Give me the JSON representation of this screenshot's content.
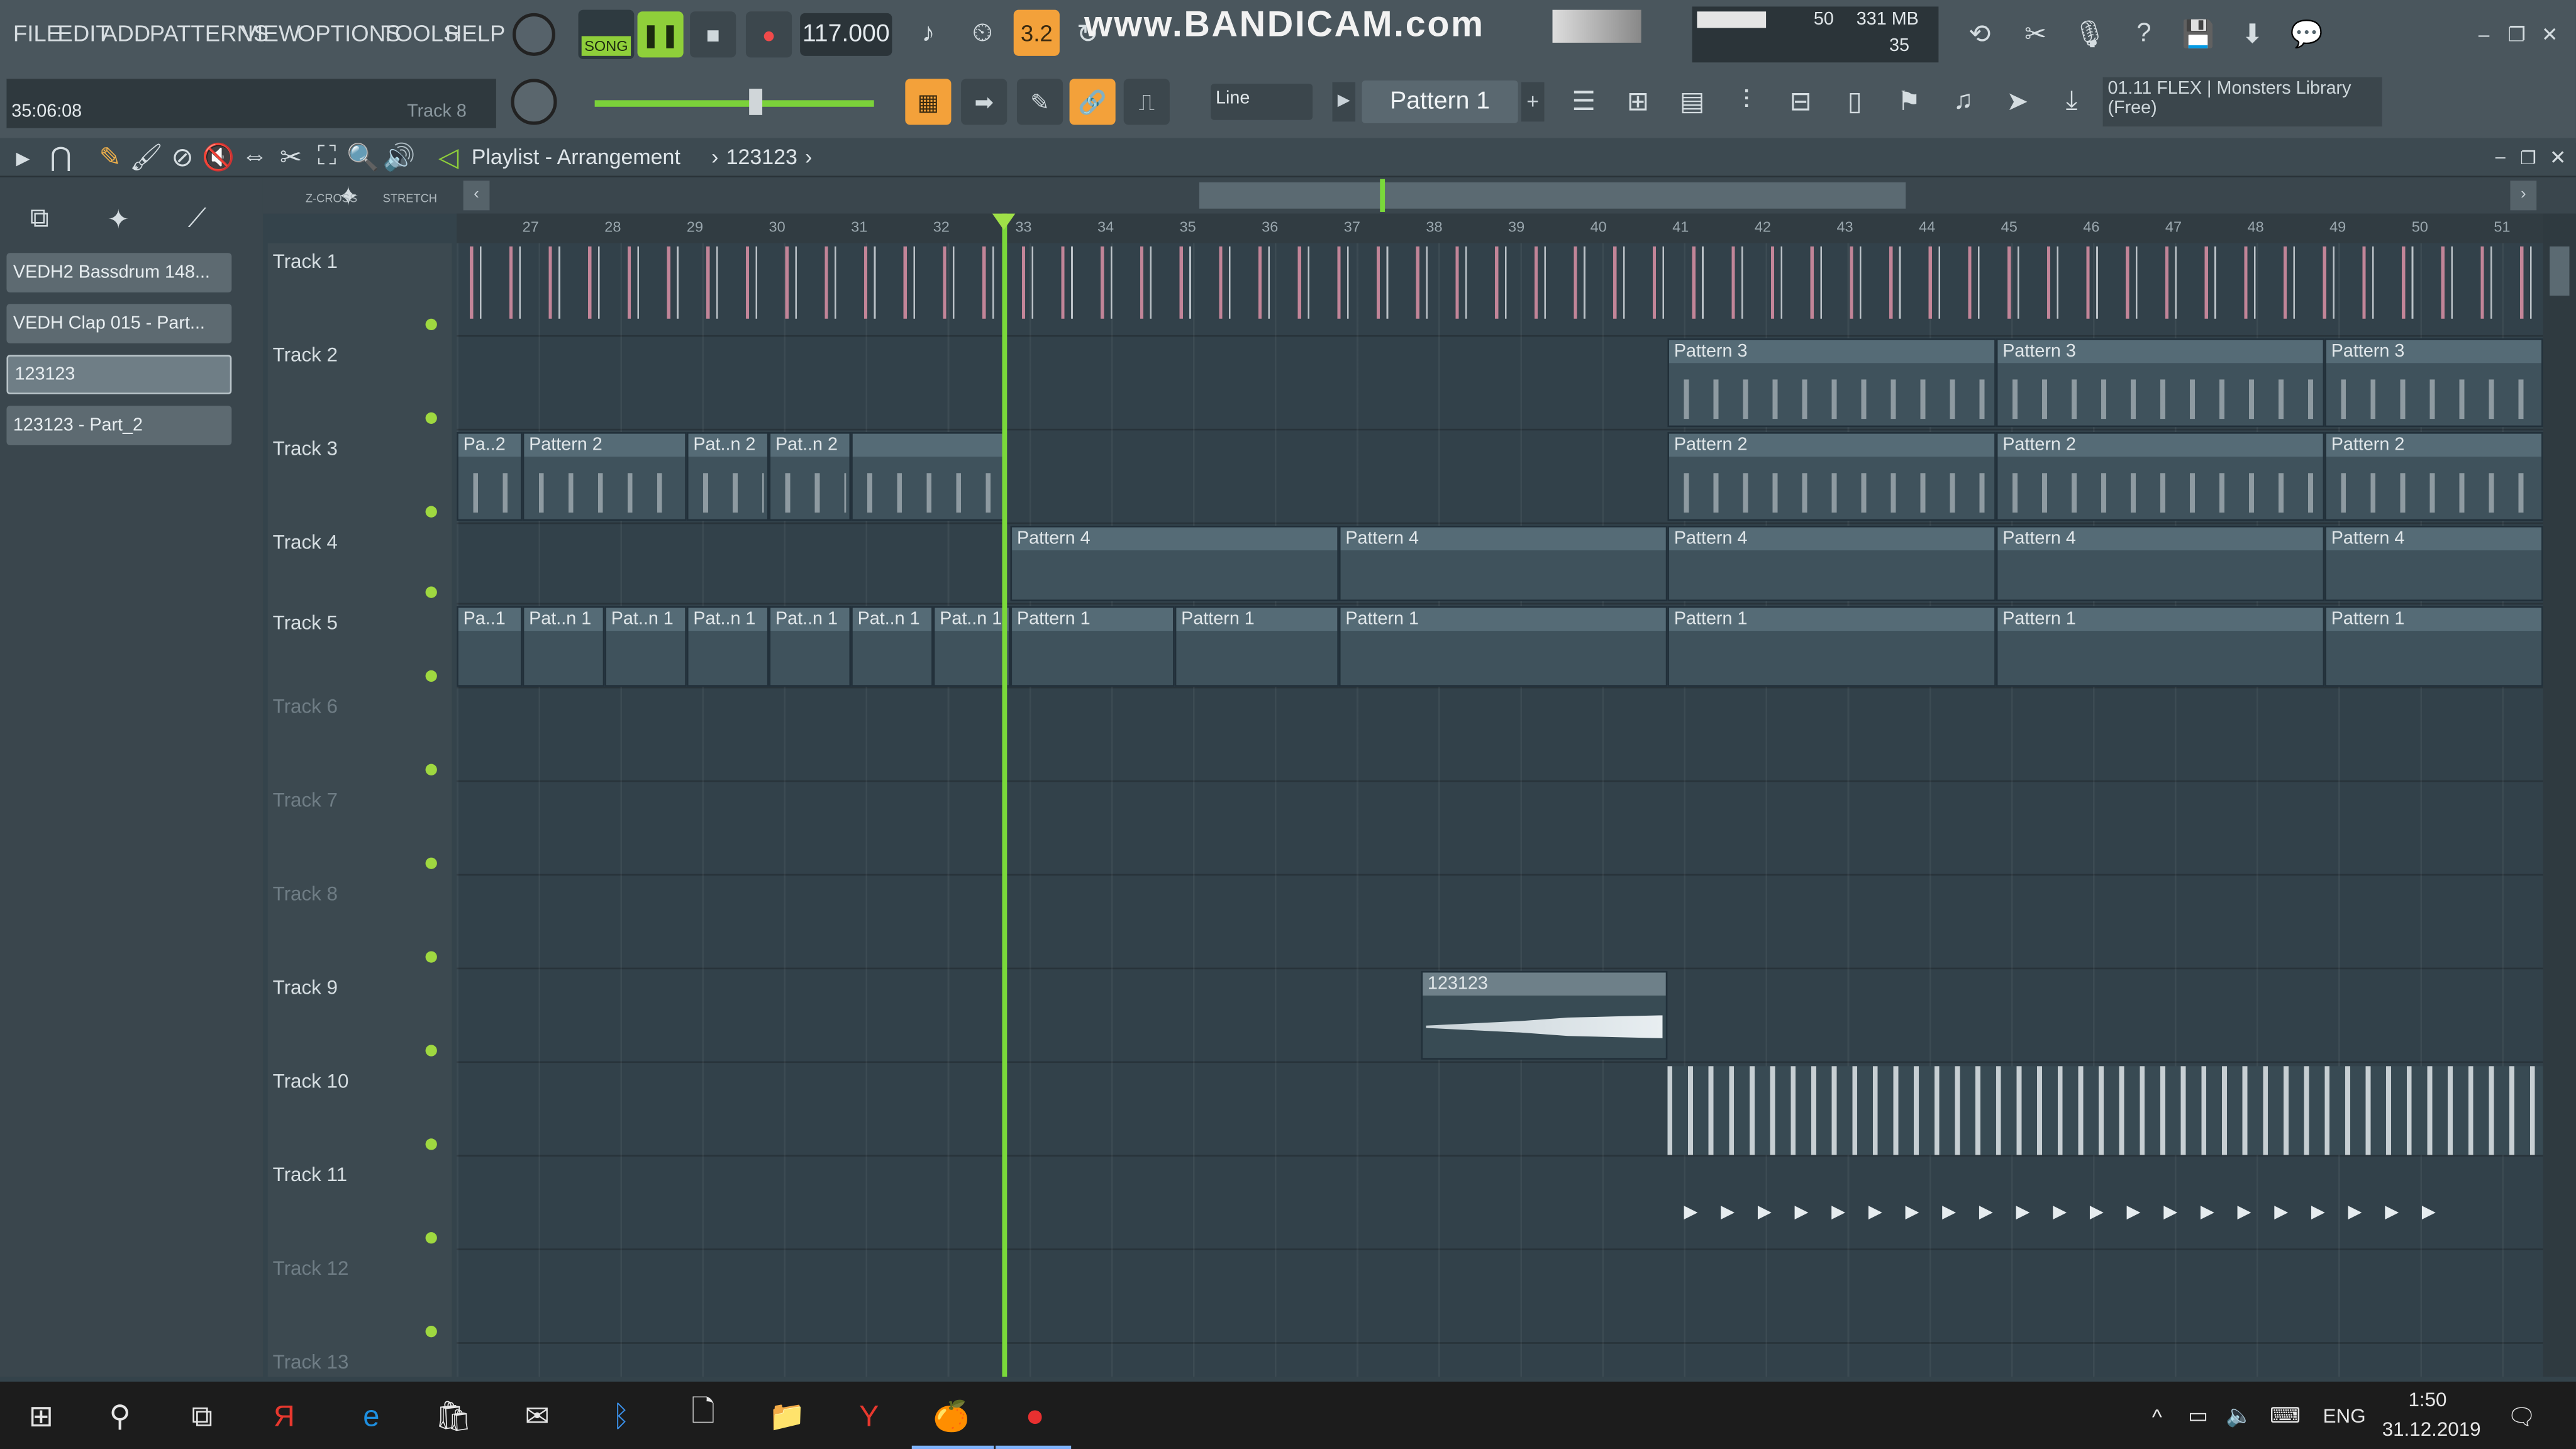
{
  "menu": [
    "FILE",
    "EDIT",
    "ADD",
    "PATTERNS",
    "VIEW",
    "OPTIONS",
    "TOOLS",
    "HELP"
  ],
  "transport": {
    "mode": "SONG",
    "tempo": "117.000",
    "time": "35:06:08",
    "hint": "Track 8",
    "counter": "3.2"
  },
  "watermark": "www.BANDICAM.com",
  "meters": {
    "cpu": "50",
    "ram": "331 MB",
    "poly": "35"
  },
  "snap": "Line",
  "pattern_selector": "Pattern 1",
  "plugin_news": {
    "line1": "01.11  FLEX | Monsters Library",
    "line2": "(Free)"
  },
  "playlist": {
    "title": "Playlist - Arrangement",
    "breadcrumb": "123123",
    "zcross": "Z-CROSS",
    "stretch": "STRETCH"
  },
  "ruler": [
    "27",
    "28",
    "29",
    "30",
    "31",
    "32",
    "33",
    "34",
    "35",
    "36",
    "37",
    "38",
    "39",
    "40",
    "41",
    "42",
    "43",
    "44",
    "45",
    "46",
    "47",
    "48",
    "49",
    "50",
    "51"
  ],
  "sidebar_items": [
    "VEDH2 Bassdrum 148...",
    "VEDH Clap 015 - Part...",
    "123123",
    "123123 - Part_2"
  ],
  "tracks": [
    "Track 1",
    "Track 2",
    "Track 3",
    "Track 4",
    "Track 5",
    "Track 6",
    "Track 7",
    "Track 8",
    "Track 9",
    "Track 10",
    "Track 11",
    "Track 12",
    "Track 13"
  ],
  "clips": {
    "p1": "Pattern 1",
    "p2": "Pattern 2",
    "p3": "Pattern 3",
    "p4": "Pattern 4",
    "pa1": "Pa..1",
    "patn1": "Pat..n 1",
    "pa2": "Pa..2",
    "patn2": "Pat..n 2",
    "audio": "123123"
  },
  "taskbar": {
    "lang": "ENG",
    "time": "1:50",
    "date": "31.12.2019"
  }
}
